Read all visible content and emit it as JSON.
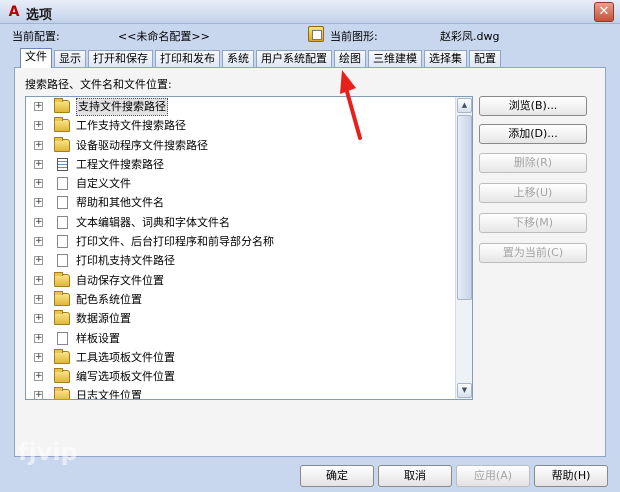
{
  "window": {
    "title": "选项",
    "close_glyph": "✕"
  },
  "profile": {
    "current_profile_label": "当前配置:",
    "current_profile_value": "<<未命名配置>>",
    "current_drawing_label": "当前图形:",
    "current_drawing_value": "赵彩凤.dwg"
  },
  "tabs": [
    {
      "label": "文件",
      "active": true
    },
    {
      "label": "显示"
    },
    {
      "label": "打开和保存"
    },
    {
      "label": "打印和发布"
    },
    {
      "label": "系统"
    },
    {
      "label": "用户系统配置"
    },
    {
      "label": "绘图"
    },
    {
      "label": "三维建模"
    },
    {
      "label": "选择集"
    },
    {
      "label": "配置"
    }
  ],
  "panel": {
    "label": "搜索路径、文件名和文件位置:"
  },
  "tree": {
    "items": [
      {
        "label": "支持文件搜索路径",
        "icon": "folder-icon",
        "selected": true
      },
      {
        "label": "工作支持文件搜索路径",
        "icon": "folder-icon"
      },
      {
        "label": "设备驱动程序文件搜索路径",
        "icon": "folder-icon"
      },
      {
        "label": "工程文件搜索路径",
        "icon": "list-icon"
      },
      {
        "label": "自定义文件",
        "icon": "file-icon"
      },
      {
        "label": "帮助和其他文件名",
        "icon": "file-icon"
      },
      {
        "label": "文本编辑器、词典和字体文件名",
        "icon": "file-icon"
      },
      {
        "label": "打印文件、后台打印程序和前导部分名称",
        "icon": "file-icon"
      },
      {
        "label": "打印机支持文件路径",
        "icon": "file-icon"
      },
      {
        "label": "自动保存文件位置",
        "icon": "folder-icon"
      },
      {
        "label": "配色系统位置",
        "icon": "folder-icon"
      },
      {
        "label": "数据源位置",
        "icon": "folder-icon"
      },
      {
        "label": "样板设置",
        "icon": "file-icon"
      },
      {
        "label": "工具选项板文件位置",
        "icon": "folder-icon"
      },
      {
        "label": "编写选项板文件位置",
        "icon": "folder-icon"
      },
      {
        "label": "日志文件位置",
        "icon": "folder-icon"
      }
    ],
    "expander_glyph": "+",
    "scroll_up_glyph": "▲",
    "scroll_down_glyph": "▼"
  },
  "side_buttons": {
    "browse": "浏览(B)...",
    "add": "添加(D)...",
    "remove": "删除(R)",
    "move_up": "上移(U)",
    "move_down": "下移(M)",
    "set_current": "置为当前(C)"
  },
  "bottom_buttons": {
    "ok": "确定",
    "cancel": "取消",
    "apply": "应用(A)",
    "help": "帮助(H)"
  },
  "watermark": "fjvip",
  "colors": {
    "annotation_arrow": "#e8201c",
    "selection": "#e2e2e2"
  }
}
